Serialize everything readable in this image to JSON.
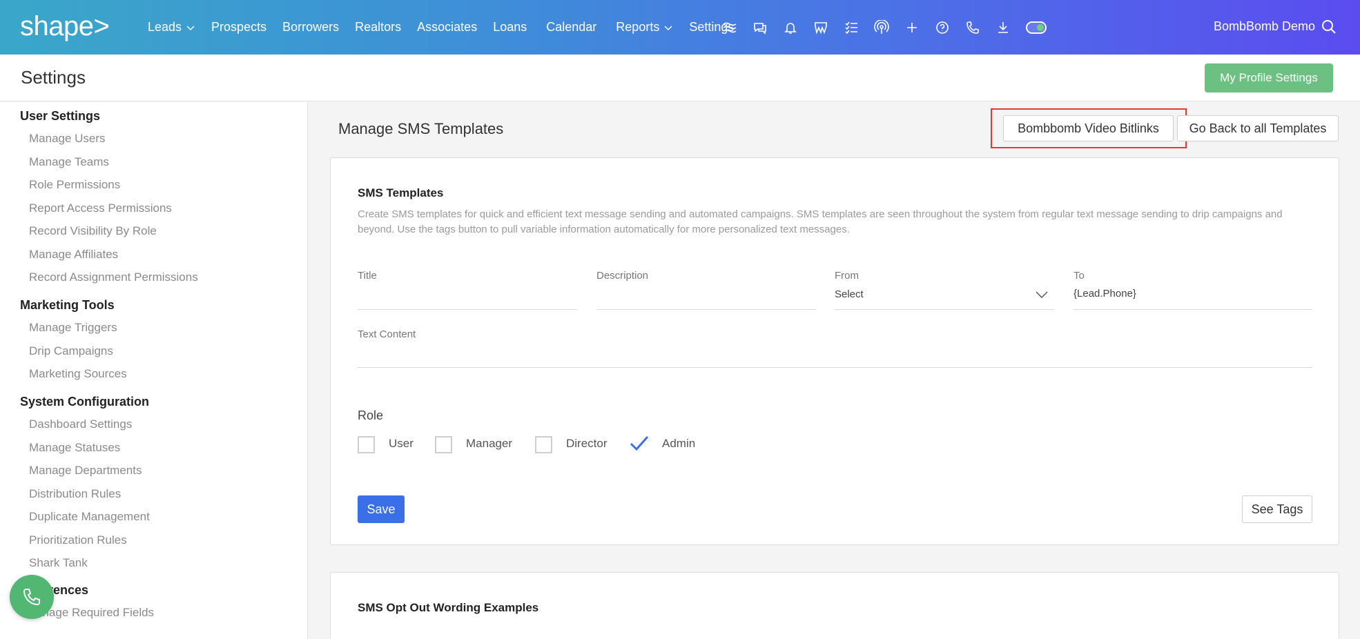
{
  "brand": {
    "logo_text": "shape>"
  },
  "nav": {
    "items": [
      {
        "label": "Leads",
        "dropdown": true
      },
      {
        "label": "Prospects",
        "dropdown": false
      },
      {
        "label": "Borrowers",
        "dropdown": false
      },
      {
        "label": "Realtors",
        "dropdown": false
      },
      {
        "label": "Associates",
        "dropdown": false
      },
      {
        "label": "Loans",
        "dropdown": false
      },
      {
        "label": "Calendar",
        "dropdown": false
      },
      {
        "label": "Reports",
        "dropdown": true
      },
      {
        "label": "Settings",
        "dropdown": false
      }
    ],
    "icons": [
      "waves-icon",
      "chat-icon",
      "bell-icon",
      "w-logo-icon",
      "checklist-icon",
      "broadcast-icon",
      "plus-icon",
      "help-icon",
      "phone-icon",
      "download-icon",
      "toggle-icon"
    ],
    "user_name": "BombBomb Demo"
  },
  "header": {
    "title": "Settings",
    "profile_button": "My Profile Settings"
  },
  "sidebar": {
    "sections": [
      {
        "heading": "User Settings",
        "items": [
          "Manage Users",
          "Manage Teams",
          "Role Permissions",
          "Report Access Permissions",
          "Record Visibility By Role",
          "Manage Affiliates",
          "Record Assignment Permissions"
        ]
      },
      {
        "heading": "Marketing Tools",
        "items": [
          "Manage Triggers",
          "Drip Campaigns",
          "Marketing Sources"
        ]
      },
      {
        "heading": "System Configuration",
        "items": [
          "Dashboard Settings",
          "Manage Statuses",
          "Manage Departments",
          "Distribution Rules",
          "Duplicate Management",
          "Prioritization Rules",
          "Shark Tank"
        ]
      },
      {
        "heading": "erences",
        "items": [
          "anage Required Fields"
        ]
      }
    ]
  },
  "main": {
    "title": "Manage SMS Templates",
    "bitlinks_button": "Bombbomb Video Bitlinks",
    "back_button": "Go Back to all Templates",
    "card": {
      "title": "SMS Templates",
      "description": "Create SMS templates for quick and efficient text message sending and automated campaigns. SMS templates are seen throughout the system from regular text message sending to drip campaigns and beyond. Use the tags button to pull variable information automatically for more personalized text messages.",
      "fields": {
        "title_label": "Title",
        "title_value": "",
        "description_label": "Description",
        "description_value": "",
        "from_label": "From",
        "from_value": "Select",
        "to_label": "To",
        "to_value": "{Lead.Phone}",
        "text_label": "Text Content",
        "text_value": ""
      },
      "role_label": "Role",
      "roles": [
        {
          "label": "User",
          "checked": false
        },
        {
          "label": "Manager",
          "checked": false
        },
        {
          "label": "Director",
          "checked": false
        },
        {
          "label": "Admin",
          "checked": true
        }
      ],
      "save_button": "Save",
      "tags_button": "See Tags"
    },
    "card2": {
      "title": "SMS Opt Out Wording Examples"
    }
  },
  "colors": {
    "accent_blue": "#3b6fe8",
    "success_green": "#6cc082",
    "highlight_red": "#ee3333"
  }
}
